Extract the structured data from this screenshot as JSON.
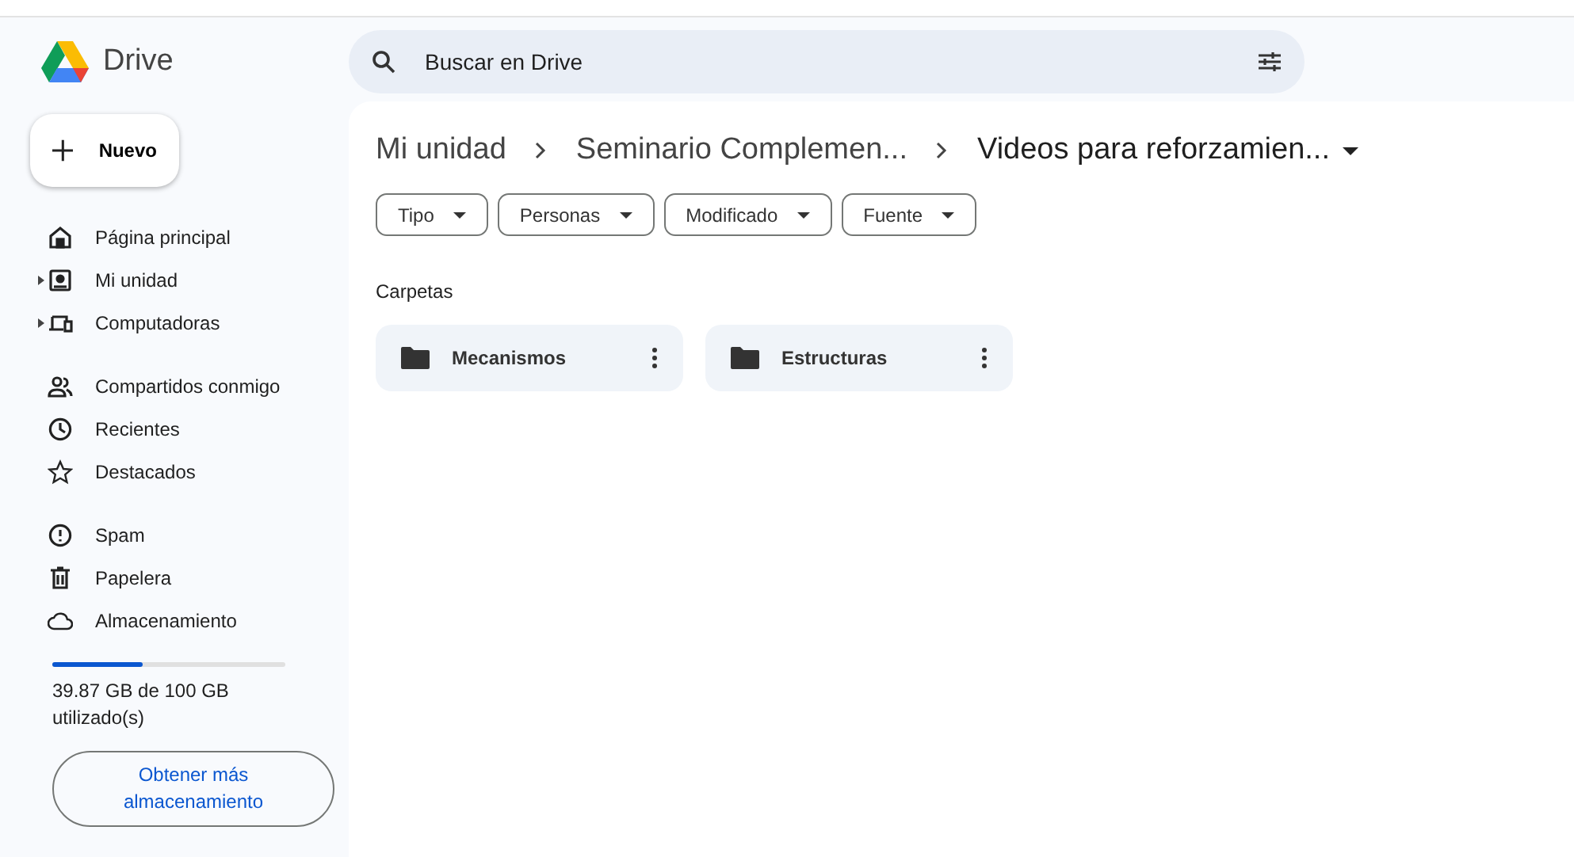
{
  "app": {
    "name": "Drive"
  },
  "search": {
    "placeholder": "Buscar en Drive"
  },
  "new_button": {
    "label": "Nuevo"
  },
  "sidebar": {
    "groups": [
      {
        "items": [
          {
            "kind": "home",
            "label": "Página principal",
            "expandable": false
          },
          {
            "kind": "drive",
            "label": "Mi unidad",
            "expandable": true
          },
          {
            "kind": "computers",
            "label": "Computadoras",
            "expandable": true
          }
        ]
      },
      {
        "items": [
          {
            "kind": "shared",
            "label": "Compartidos conmigo",
            "expandable": false
          },
          {
            "kind": "recent",
            "label": "Recientes",
            "expandable": false
          },
          {
            "kind": "starred",
            "label": "Destacados",
            "expandable": false
          }
        ]
      },
      {
        "items": [
          {
            "kind": "spam",
            "label": "Spam",
            "expandable": false
          },
          {
            "kind": "trash",
            "label": "Papelera",
            "expandable": false
          },
          {
            "kind": "storage",
            "label": "Almacenamiento",
            "expandable": false
          }
        ]
      }
    ]
  },
  "storage": {
    "level": 0.39,
    "usage": "39.87 GB de 100 GB utilizado(s)",
    "button": "Obtener más almacenamiento"
  },
  "breadcrumbs": [
    "Mi unidad",
    "Seminario Complemen...",
    "Videos para reforzamien..."
  ],
  "filters": [
    "Tipo",
    "Personas",
    "Modificado",
    "Fuente"
  ],
  "section_title": "Carpetas",
  "folders": [
    {
      "name": "Mecanismos"
    },
    {
      "name": "Estructuras"
    }
  ]
}
